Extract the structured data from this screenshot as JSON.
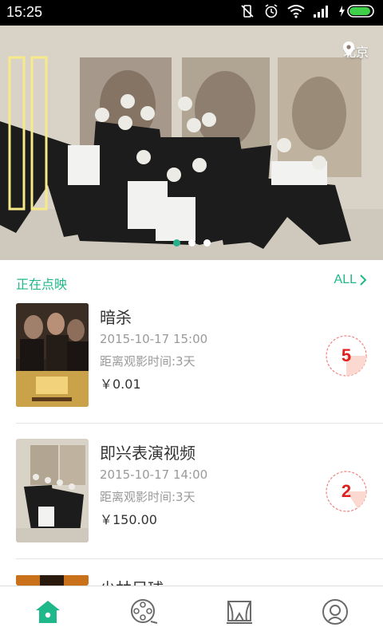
{
  "status_bar": {
    "time": "15:25"
  },
  "banner": {
    "location": "北京",
    "page_count": 3,
    "active_page": 1
  },
  "section": {
    "title": "正在点映",
    "all_label": "ALL"
  },
  "list": [
    {
      "title": "暗杀",
      "datetime": "2015-10-17 15:00",
      "countdown": "距离观影时间:3天",
      "price": "￥0.01",
      "days": "5"
    },
    {
      "title": "即兴表演视频",
      "datetime": "2015-10-17 14:00",
      "countdown": "距离观影时间:3天",
      "price": "￥150.00",
      "days": "2"
    },
    {
      "title": "少林足球"
    }
  ],
  "tabbar": {
    "tabs": [
      "home-icon",
      "film-reel-icon",
      "theater-stage-icon",
      "profile-icon"
    ],
    "active": 0
  },
  "colors": {
    "accent": "#1fb88a",
    "badge": "#e02020"
  }
}
